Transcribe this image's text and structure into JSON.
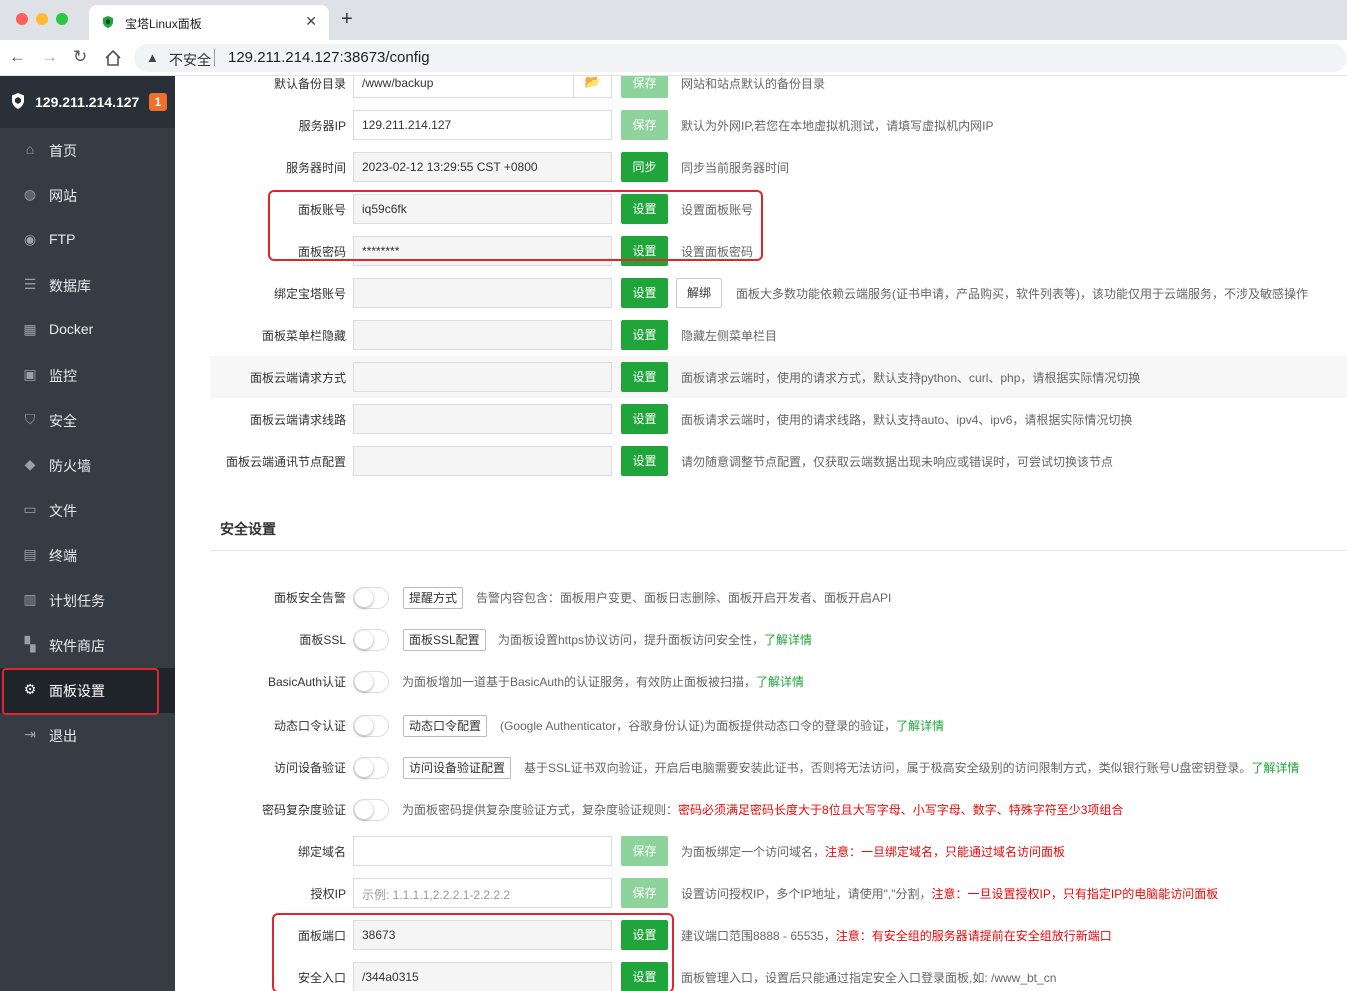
{
  "browser": {
    "tab_title": "宝塔Linux面板",
    "tab_close": "✕",
    "new_tab": "+",
    "insecure_label": "不安全",
    "url": "129.211.214.127:38673/config"
  },
  "sidebar": {
    "ip": "129.211.214.127",
    "badge": "1",
    "items": [
      {
        "label": "首页",
        "icon": "home-icon"
      },
      {
        "label": "网站",
        "icon": "globe-icon"
      },
      {
        "label": "FTP",
        "icon": "ftp-icon"
      },
      {
        "label": "数据库",
        "icon": "database-icon"
      },
      {
        "label": "Docker",
        "icon": "docker-icon"
      },
      {
        "label": "监控",
        "icon": "monitor-icon"
      },
      {
        "label": "安全",
        "icon": "shield-icon"
      },
      {
        "label": "防火墙",
        "icon": "firewall-icon"
      },
      {
        "label": "文件",
        "icon": "folder-icon"
      },
      {
        "label": "终端",
        "icon": "terminal-icon"
      },
      {
        "label": "计划任务",
        "icon": "calendar-icon"
      },
      {
        "label": "软件商店",
        "icon": "apps-icon"
      },
      {
        "label": "面板设置",
        "icon": "gear-icon"
      },
      {
        "label": "退出",
        "icon": "logout-icon"
      }
    ]
  },
  "settings": {
    "backup_dir": {
      "label": "默认备份目录",
      "value": "/www/backup",
      "button": "保存",
      "desc": "网站和站点默认的备份目录"
    },
    "server_ip": {
      "label": "服务器IP",
      "value": "129.211.214.127",
      "button": "保存",
      "desc": "默认为外网IP,若您在本地虚拟机测试，请填写虚拟机内网IP"
    },
    "server_time": {
      "label": "服务器时间",
      "value": "2023-02-12 13:29:55 CST +0800",
      "button": "同步",
      "desc": "同步当前服务器时间"
    },
    "panel_user": {
      "label": "面板账号",
      "value": "iq59c6fk",
      "button": "设置",
      "desc": "设置面板账号"
    },
    "panel_password": {
      "label": "面板密码",
      "value": "********",
      "button": "设置",
      "desc": "设置面板密码"
    },
    "bind_bt": {
      "label": "绑定宝塔账号",
      "value": "",
      "button": "设置",
      "unbind": "解绑",
      "desc": "面板大多数功能依赖云端服务(证书申请，产品购买，软件列表等)，该功能仅用于云端服务，不涉及敏感操作"
    },
    "hide_menu": {
      "label": "面板菜单栏隐藏",
      "value": "",
      "button": "设置",
      "desc": "隐藏左侧菜单栏目"
    },
    "cloud_method": {
      "label": "面板云端请求方式",
      "value": "",
      "button": "设置",
      "desc": "面板请求云端时，使用的请求方式，默认支持python、curl、php，请根据实际情况切换"
    },
    "cloud_line": {
      "label": "面板云端请求线路",
      "value": "",
      "button": "设置",
      "desc": "面板请求云端时，使用的请求线路，默认支持auto、ipv4、ipv6，请根据实际情况切换"
    },
    "cloud_node": {
      "label": "面板云端通讯节点配置",
      "value": "",
      "button": "设置",
      "desc": "请勿随意调整节点配置，仅获取云端数据出现未响应或错误时，可尝试切换该节点"
    }
  },
  "security": {
    "title": "安全设置",
    "alert": {
      "label": "面板安全告警",
      "button": "提醒方式",
      "desc": "告警内容包含：面板用户变更、面板日志删除、面板开启开发者、面板开启API"
    },
    "ssl": {
      "label": "面板SSL",
      "button": "面板SSL配置",
      "desc": "为面板设置https协议访问，提升面板访问安全性，",
      "link": "了解详情"
    },
    "basic_auth": {
      "label": "BasicAuth认证",
      "desc": "为面板增加一道基于BasicAuth的认证服务，有效防止面板被扫描，",
      "link": "了解详情"
    },
    "otp": {
      "label": "动态口令认证",
      "button": "动态口令配置",
      "desc": "(Google Authenticator，谷歌身份认证)为面板提供动态口令的登录的验证，",
      "link": "了解详情"
    },
    "device": {
      "label": "访问设备验证",
      "button": "访问设备验证配置",
      "desc": "基于SSL证书双向验证，开启后电脑需要安装此证书，否则将无法访问，属于极高安全级别的访问限制方式，类似银行账号U盘密钥登录。",
      "link": "了解详情"
    },
    "pwd_complex": {
      "label": "密码复杂度验证",
      "desc": "为面板密码提供复杂度验证方式，复杂度验证规则：",
      "warn": "密码必须满足密码长度大于8位且大写字母、小写字母、数字、特殊字符至少3项组合"
    },
    "bind_domain": {
      "label": "绑定域名",
      "value": "",
      "button": "保存",
      "desc": "为面板绑定一个访问域名，",
      "warn": "注意：一旦绑定域名，只能通过域名访问面板"
    },
    "auth_ip": {
      "label": "授权IP",
      "placeholder": "示例: 1.1.1.1,2.2.2.1-2.2.2.2",
      "button": "保存",
      "desc": "设置访问授权IP，多个IP地址，请使用\",\"分割，",
      "warn": "注意：一旦设置授权IP，只有指定IP的电脑能访问面板"
    },
    "panel_port": {
      "label": "面板端口",
      "value": "38673",
      "button": "设置",
      "desc": "建议端口范围8888 - 65535，",
      "warn": "注意：有安全组的服务器请提前在安全组放行新端口"
    },
    "entry": {
      "label": "安全入口",
      "value": "/344a0315",
      "button": "设置",
      "desc": "面板管理入口，设置后只能通过指定安全入口登录面板,如: /www_bt_cn"
    }
  },
  "colors": {
    "accent": "#20a53a",
    "sidebar": "#353c44",
    "highlight": "#e0262c",
    "warn": "#ef0808"
  }
}
